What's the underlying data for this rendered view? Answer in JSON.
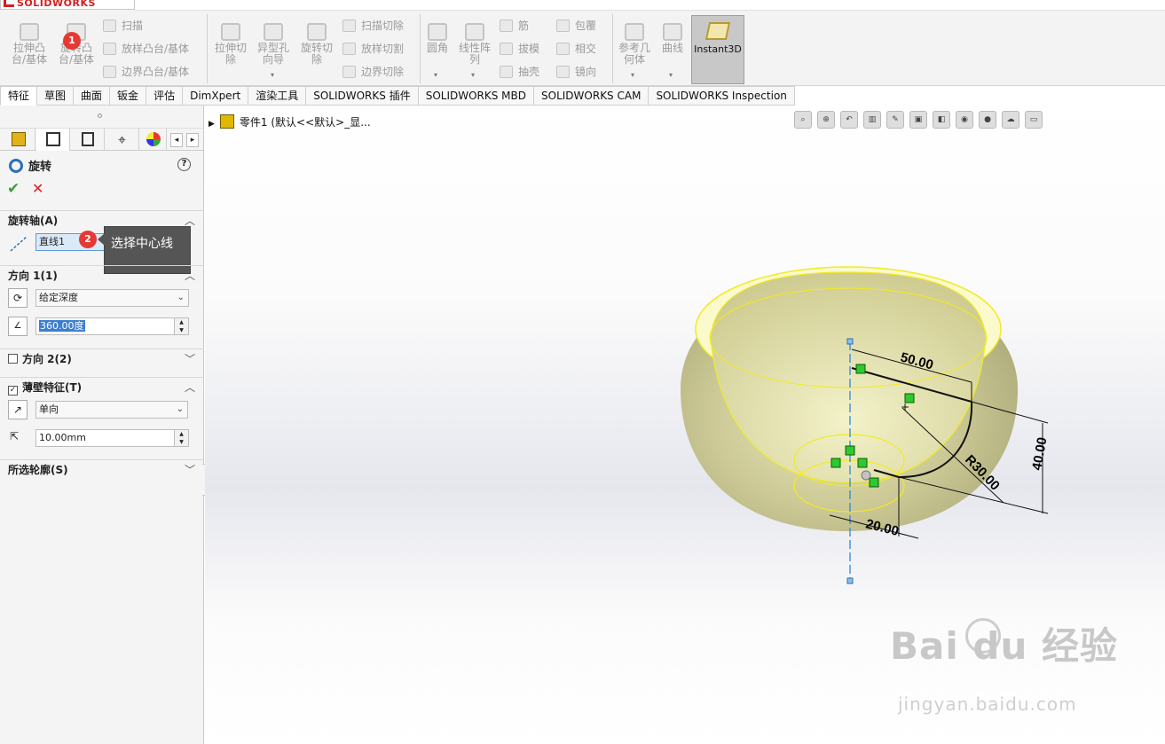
{
  "app": {
    "brand": "SOLIDWORKS"
  },
  "ribbon": {
    "extrude_boss": "拉伸凸\n台/基体",
    "revolve_boss": "旋转凸\n台/基体",
    "sweep": "扫描",
    "loft": "放样凸台/基体",
    "boundary": "边界凸台/基体",
    "extrude_cut": "拉伸切\n除",
    "hole_wizard": "异型孔\n向导",
    "revolve_cut": "旋转切\n除",
    "swept_cut": "扫描切除",
    "lofted_cut": "放样切割",
    "boundary_cut": "边界切除",
    "fillet": "圆角",
    "linear_pattern": "线性阵\n列",
    "rib": "筋",
    "draft": "拔模",
    "shell": "抽壳",
    "wrap": "包覆",
    "intersect": "相交",
    "mirror": "镜向",
    "ref_geometry": "参考几\n何体",
    "curves": "曲线",
    "instant3d": "Instant3D",
    "step1_badge": "1"
  },
  "tabs": [
    "特征",
    "草图",
    "曲面",
    "钣金",
    "评估",
    "DimXpert",
    "渲染工具",
    "SOLIDWORKS 插件",
    "SOLIDWORKS MBD",
    "SOLIDWORKS CAM",
    "SOLIDWORKS Inspection"
  ],
  "panel": {
    "title": "旋转",
    "help": "?",
    "axis": {
      "header": "旋转轴(A)",
      "value": "直线1",
      "badge": "2",
      "tooltip": "选择中心线"
    },
    "direction1": {
      "header": "方向 1(1)",
      "type": "给定深度",
      "angle": "360.00度"
    },
    "direction2": {
      "header": "方向 2(2)"
    },
    "thin": {
      "header": "薄壁特征(T)",
      "type": "单向",
      "thickness": "10.00mm"
    },
    "contours": {
      "header": "所选轮廓(S)"
    }
  },
  "viewport": {
    "tree_item": "零件1  (默认<<默认>_显...",
    "dims": {
      "d1": "50.00",
      "d2": "40.00",
      "d3": "R30.00",
      "d4": "20.00"
    }
  },
  "watermark": {
    "brand": "Bai du 经验",
    "url": "jingyan.baidu.com"
  }
}
